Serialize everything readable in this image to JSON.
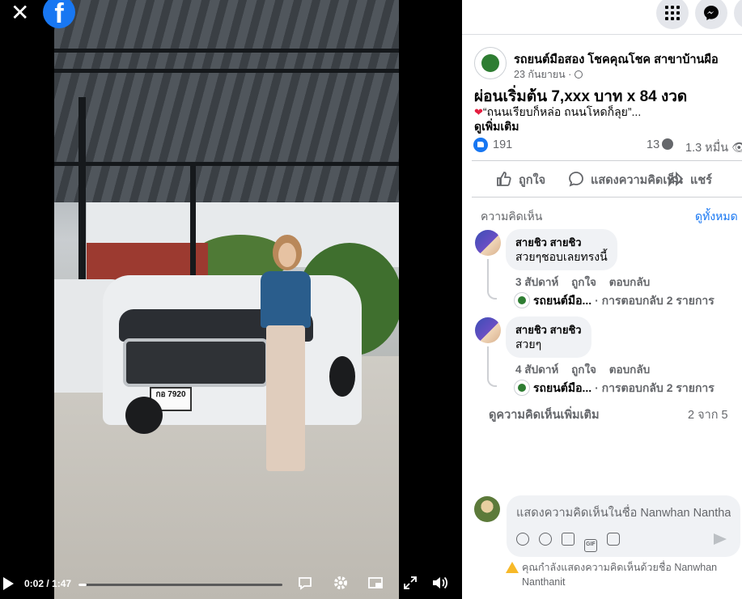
{
  "video": {
    "close_icon": "✕",
    "fb_logo": "f",
    "plate": "กอ 7920",
    "time": "0:02 / 1:47",
    "progress": 0.019,
    "controls": [
      "captions-icon",
      "settings-icon",
      "pip-icon",
      "fullscreen-icon",
      "volume-icon"
    ]
  },
  "topbar": {
    "buttons": [
      "menu-grid-icon",
      "messenger-icon",
      "notifications-icon"
    ]
  },
  "post": {
    "page_name": "รถยนต์มือสอง โชคคุณโชค สาขาบ้านผือ",
    "date": "23 กันยายน ·",
    "title": "ผ่อนเริ่มต้น 7,xxx บาท x 84 งวด",
    "subtitle": "“ถนนเรียบก็หล่อ ถนนโหดก็ลุย”...",
    "see_more": "ดูเพิ่มเติม",
    "likes": "191",
    "comments_count": "13",
    "views": "1.3 หมื่น"
  },
  "actions": {
    "like": "ถูกใจ",
    "comment": "แสดงความคิดเห็น",
    "share": "แชร์"
  },
  "comments_section": {
    "label": "ความคิดเห็น",
    "see_all": "ดูทั้งหมด",
    "items": [
      {
        "name": "สายชิว สายชิว",
        "text": "สวยๆชอบเลยทรงนี้",
        "time": "3 สัปดาห์",
        "like": "ถูกใจ",
        "reply": "ตอบกลับ",
        "reply_author": "รถยนต์มือ...",
        "reply_count": "· การตอบกลับ 2 รายการ"
      },
      {
        "name": "สายชิว สายชิว",
        "text": "สวยๆ",
        "time": "4 สัปดาห์",
        "like": "ถูกใจ",
        "reply": "ตอบกลับ",
        "reply_author": "รถยนต์มือ...",
        "reply_count": "· การตอบกลับ 2 รายการ"
      }
    ],
    "more": "ดูความคิดเห็นเพิ่มเติม",
    "count": "2 จาก 5"
  },
  "composer": {
    "placeholder": "แสดงความคิดเห็นในชื่อ Nanwhan Nanthanit",
    "tools": [
      "😊",
      "☺",
      "📷",
      "GIF",
      "🏷"
    ],
    "notice": "คุณกำลังแสดงความคิดเห็นด้วยชื่อ Nanwhan Nanthanit"
  },
  "colors": {
    "accent": "#1877f2",
    "secondary_text": "#65676b",
    "bubble_bg": "#f0f2f5"
  }
}
